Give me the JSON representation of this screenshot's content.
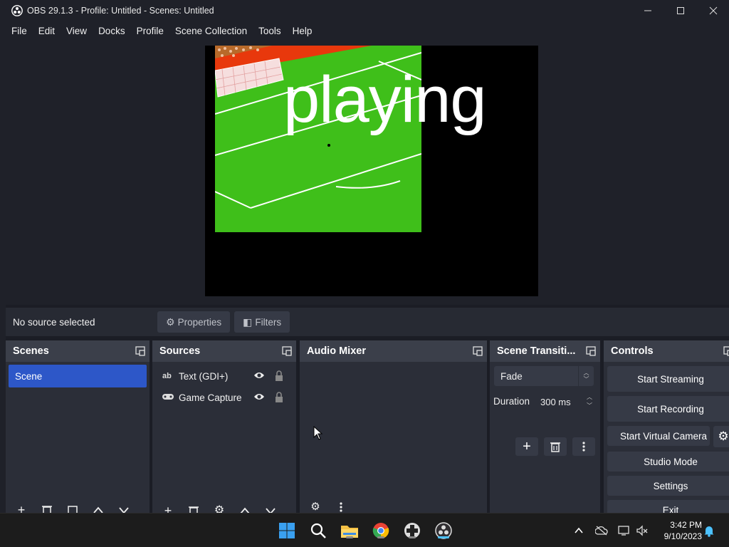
{
  "window": {
    "title": "OBS 29.1.3 - Profile: Untitled - Scenes: Untitled",
    "minimize_icon": "minimize-icon",
    "maximize_icon": "maximize-icon",
    "close_icon": "close-icon"
  },
  "menu": [
    "File",
    "Edit",
    "View",
    "Docks",
    "Profile",
    "Scene Collection",
    "Tools",
    "Help"
  ],
  "preview": {
    "overlay_text": "playing"
  },
  "source_toolbar": {
    "status": "No source selected",
    "properties_label": "Properties",
    "filters_label": "Filters"
  },
  "scenes": {
    "title": "Scenes",
    "items": [
      "Scene"
    ]
  },
  "sources": {
    "title": "Sources",
    "items": [
      {
        "label": "Text (GDI+)",
        "icon": "text-icon",
        "icon_glyph": "ab"
      },
      {
        "label": "Game Capture",
        "icon": "gamepad-icon"
      }
    ]
  },
  "audio_mixer": {
    "title": "Audio Mixer"
  },
  "transitions": {
    "title": "Scene Transiti...",
    "selected": "Fade",
    "duration_label": "Duration",
    "duration_value": "300 ms"
  },
  "controls": {
    "title": "Controls",
    "start_streaming": "Start Streaming",
    "start_recording": "Start Recording",
    "start_virtual_camera": "Start Virtual Camera",
    "studio_mode": "Studio Mode",
    "settings": "Settings",
    "exit": "Exit"
  },
  "taskbar": {
    "time": "3:42 PM",
    "date": "9/10/2023"
  },
  "colors": {
    "accent": "#2d57c8",
    "panel": "#2b2e38",
    "header": "#3b3f4a",
    "field_green": "#3fbf1a"
  }
}
